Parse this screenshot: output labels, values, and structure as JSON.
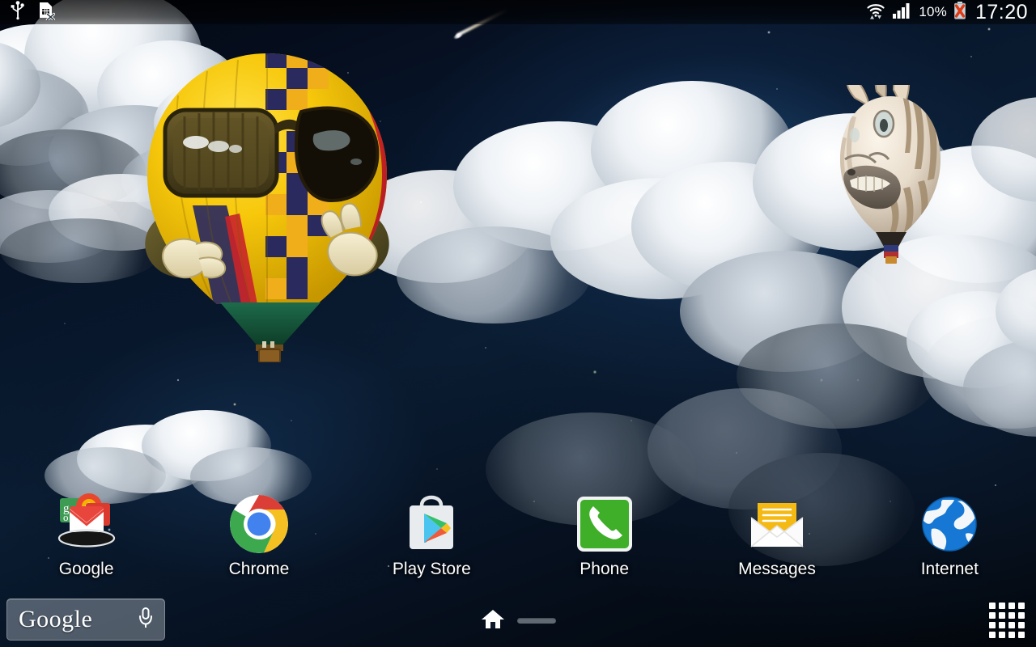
{
  "device": {
    "platform": "Android home screen",
    "resolution": "1280x800"
  },
  "status_bar": {
    "left_icons": [
      {
        "name": "usb-icon",
        "glyph": "usb"
      },
      {
        "name": "no-sim-card-icon",
        "glyph": "sim-card-x"
      }
    ],
    "right_icons": [
      {
        "name": "wifi-icon",
        "glyph": "wifi-transfer"
      },
      {
        "name": "signal-bars-icon",
        "glyph": "signal-4-bars"
      },
      {
        "name": "battery-error-icon",
        "glyph": "battery-x"
      }
    ],
    "battery_percent": "10%",
    "clock": "17:20"
  },
  "wallpaper": {
    "description": "Night sky with stars, blue nebula glow, large white clouds and two character hot-air balloons",
    "comet": {
      "name": "shooting-star",
      "visible": true
    },
    "balloons": [
      {
        "name": "smiley-sunglasses-balloon",
        "colors": {
          "envelope": "#f2c500",
          "accent_red": "#d32024",
          "accent_navy": "#2b2a5e",
          "glasses": "#4a3f1e",
          "skirt_green": "#16503a"
        }
      },
      {
        "name": "zebra-balloon",
        "colors": {
          "body": "#efe6d8",
          "stripes": "#9d8468",
          "muzzle": "#6d6257"
        }
      }
    ]
  },
  "home_screen": {
    "apps": [
      {
        "label": "Google",
        "icon": "google-folder-icon"
      },
      {
        "label": "Chrome",
        "icon": "chrome-icon"
      },
      {
        "label": "Play Store",
        "icon": "play-store-icon"
      },
      {
        "label": "Phone",
        "icon": "phone-icon"
      },
      {
        "label": "Messages",
        "icon": "messages-icon"
      },
      {
        "label": "Internet",
        "icon": "internet-globe-icon"
      }
    ]
  },
  "bottom_bar": {
    "search_widget": {
      "logo_text": "Google",
      "mic_icon": "microphone-icon"
    },
    "page_indicators": [
      {
        "name": "page-indicator-home",
        "type": "home",
        "active": true
      },
      {
        "name": "page-indicator-2",
        "type": "pill",
        "active": false
      }
    ],
    "app_drawer": {
      "name": "app-drawer-button",
      "icon": "grid-icon",
      "cells": 16
    }
  },
  "colors": {
    "status_text": "#ffffff",
    "label_text": "#ffffff",
    "search_bar_bg": "rgba(180,190,200,0.42)",
    "accent_chrome_blue": "#4285f4",
    "accent_phone_green": "#3fae29",
    "accent_messages_yellow": "#f5b914",
    "accent_internet_blue": "#1678d4"
  }
}
